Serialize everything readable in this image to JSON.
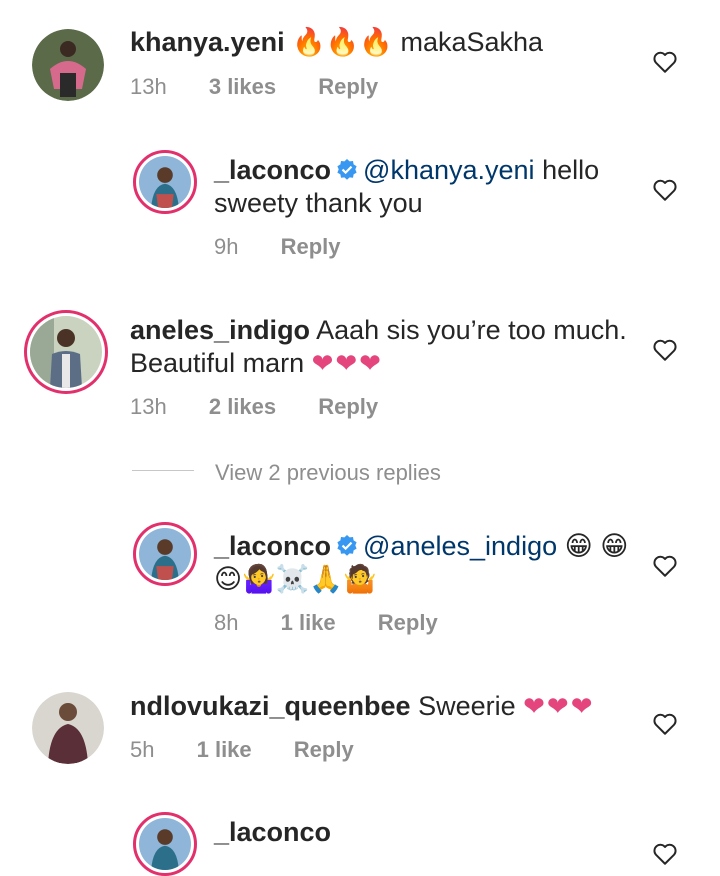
{
  "comments": [
    {
      "username": "khanya.yeni",
      "text": "🔥🔥🔥 makaSakha",
      "time": "13h",
      "likes": "3 likes",
      "reply": "Reply"
    },
    {
      "username": "_laconco",
      "mention": "@khanya.yeni",
      "text": " hello sweety thank  you",
      "time": "9h",
      "reply": "Reply"
    },
    {
      "username": "aneles_indigo",
      "text": " Aaah sis you’re too much. Beautiful marn ",
      "hearts": "❤❤❤",
      "time": "13h",
      "likes": "2 likes",
      "reply": "Reply"
    },
    {
      "username": "_laconco",
      "mention": "@aneles_indigo",
      "text": " 😁 😁😊🤷‍♀️☠️🙏🤷",
      "time": "8h",
      "likes": "1 like",
      "reply": "Reply"
    },
    {
      "username": "ndlovukazi_queenbee",
      "text": " Sweerie ",
      "hearts": "❤❤❤",
      "time": "5h",
      "likes": "1 like",
      "reply": "Reply"
    },
    {
      "username": "_laconco"
    }
  ],
  "view_replies": "View 2 previous replies",
  "colors": {
    "username": "#262626",
    "mention": "#00376b",
    "meta": "#8e8e8e",
    "heart": "#e4457d",
    "verified": "#3897f0",
    "story_ring": "#e1306c"
  }
}
